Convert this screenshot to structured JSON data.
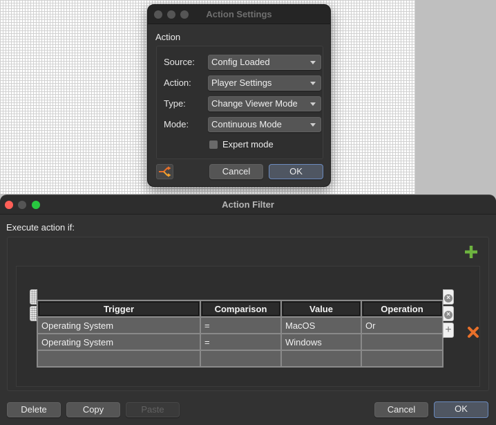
{
  "action_settings": {
    "title": "Action Settings",
    "group_label": "Action",
    "fields": [
      {
        "label": "Source:",
        "value": "Config Loaded"
      },
      {
        "label": "Action:",
        "value": "Player Settings"
      },
      {
        "label": "Type:",
        "value": "Change Viewer Mode"
      },
      {
        "label": "Mode:",
        "value": "Continuous Mode"
      }
    ],
    "expert_mode": {
      "label": "Expert mode",
      "checked": false
    },
    "filter_icon": "branch-filter-icon",
    "cancel_label": "Cancel",
    "ok_label": "OK"
  },
  "action_filter": {
    "title": "Action Filter",
    "execute_label": "Execute action if:",
    "table": {
      "columns": [
        "Trigger",
        "Comparison",
        "Value",
        "Operation"
      ],
      "rows": [
        [
          "Operating System",
          "=",
          "MacOS",
          "Or"
        ],
        [
          "Operating System",
          "=",
          "Windows",
          ""
        ],
        [
          "",
          "",
          "",
          ""
        ]
      ]
    },
    "add_icon": "green-plus-icon",
    "delete_icon": "orange-x-icon",
    "buttons": {
      "delete": "Delete",
      "copy": "Copy",
      "paste": "Paste",
      "cancel": "Cancel",
      "ok": "OK"
    },
    "row_remove_glyph": "×",
    "row_add_glyph": "+"
  },
  "colors": {
    "accent_orange": "#e8702a",
    "accent_green": "#6db33f",
    "default_button_border": "#6b8bbf"
  }
}
